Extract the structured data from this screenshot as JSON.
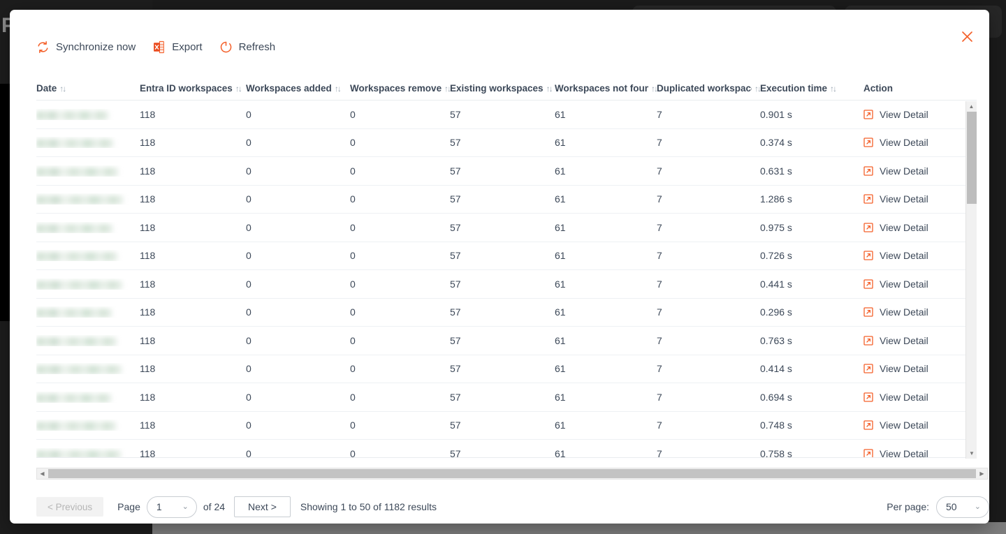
{
  "background": {
    "brand_letter": "P"
  },
  "modal": {
    "close_icon": "close-icon",
    "toolbar": {
      "items": [
        {
          "label": "Synchronize now",
          "icon": "sync-icon"
        },
        {
          "label": "Export",
          "icon": "excel-export-icon"
        },
        {
          "label": "Refresh",
          "icon": "refresh-icon"
        }
      ]
    },
    "table": {
      "columns": [
        {
          "label": "Date",
          "sortable": true,
          "key": "date"
        },
        {
          "label": "Entra ID workspaces",
          "sortable": true,
          "key": "entra"
        },
        {
          "label": "Workspaces added",
          "sortable": true,
          "key": "added"
        },
        {
          "label": "Workspaces removed",
          "sortable": true,
          "key": "removed"
        },
        {
          "label": "Existing workspaces",
          "sortable": true,
          "key": "existing"
        },
        {
          "label": "Workspaces not found",
          "sortable": true,
          "key": "notfound"
        },
        {
          "label": "Duplicated workspaces",
          "sortable": true,
          "key": "duplicated"
        },
        {
          "label": "Execution time",
          "sortable": true,
          "key": "exec"
        },
        {
          "label": "Action",
          "sortable": false,
          "key": "action"
        }
      ],
      "action_label": "View Detail",
      "action_icon": "external-link-icon",
      "date_redacted": true,
      "rows": [
        {
          "date": "",
          "entra": "118",
          "added": "0",
          "removed": "0",
          "existing": "57",
          "notfound": "61",
          "duplicated": "7",
          "exec": "0.901 s",
          "action": "View Detail"
        },
        {
          "date": "",
          "entra": "118",
          "added": "0",
          "removed": "0",
          "existing": "57",
          "notfound": "61",
          "duplicated": "7",
          "exec": "0.374 s",
          "action": "View Detail"
        },
        {
          "date": "",
          "entra": "118",
          "added": "0",
          "removed": "0",
          "existing": "57",
          "notfound": "61",
          "duplicated": "7",
          "exec": "0.631 s",
          "action": "View Detail"
        },
        {
          "date": "",
          "entra": "118",
          "added": "0",
          "removed": "0",
          "existing": "57",
          "notfound": "61",
          "duplicated": "7",
          "exec": "1.286 s",
          "action": "View Detail"
        },
        {
          "date": "",
          "entra": "118",
          "added": "0",
          "removed": "0",
          "existing": "57",
          "notfound": "61",
          "duplicated": "7",
          "exec": "0.975 s",
          "action": "View Detail"
        },
        {
          "date": "",
          "entra": "118",
          "added": "0",
          "removed": "0",
          "existing": "57",
          "notfound": "61",
          "duplicated": "7",
          "exec": "0.726 s",
          "action": "View Detail"
        },
        {
          "date": "",
          "entra": "118",
          "added": "0",
          "removed": "0",
          "existing": "57",
          "notfound": "61",
          "duplicated": "7",
          "exec": "0.441 s",
          "action": "View Detail"
        },
        {
          "date": "",
          "entra": "118",
          "added": "0",
          "removed": "0",
          "existing": "57",
          "notfound": "61",
          "duplicated": "7",
          "exec": "0.296 s",
          "action": "View Detail"
        },
        {
          "date": "",
          "entra": "118",
          "added": "0",
          "removed": "0",
          "existing": "57",
          "notfound": "61",
          "duplicated": "7",
          "exec": "0.763 s",
          "action": "View Detail"
        },
        {
          "date": "",
          "entra": "118",
          "added": "0",
          "removed": "0",
          "existing": "57",
          "notfound": "61",
          "duplicated": "7",
          "exec": "0.414 s",
          "action": "View Detail"
        },
        {
          "date": "",
          "entra": "118",
          "added": "0",
          "removed": "0",
          "existing": "57",
          "notfound": "61",
          "duplicated": "7",
          "exec": "0.694 s",
          "action": "View Detail"
        },
        {
          "date": "",
          "entra": "118",
          "added": "0",
          "removed": "0",
          "existing": "57",
          "notfound": "61",
          "duplicated": "7",
          "exec": "0.748 s",
          "action": "View Detail"
        },
        {
          "date": "",
          "entra": "118",
          "added": "0",
          "removed": "0",
          "existing": "57",
          "notfound": "61",
          "duplicated": "7",
          "exec": "0.758 s",
          "action": "View Detail"
        }
      ]
    },
    "footer": {
      "previous_label": "< Previous",
      "page_label": "Page",
      "page_value": "1",
      "of_label": "of 24",
      "next_label": "Next >",
      "showing_label": "Showing 1 to 50 of 1182 results",
      "per_page_label": "Per page:",
      "per_page_value": "50"
    }
  },
  "colors": {
    "accent": "#f4602a",
    "text": "#3c4858",
    "border": "#e9ecef",
    "scroll_thumb": "#bdbdbd"
  }
}
